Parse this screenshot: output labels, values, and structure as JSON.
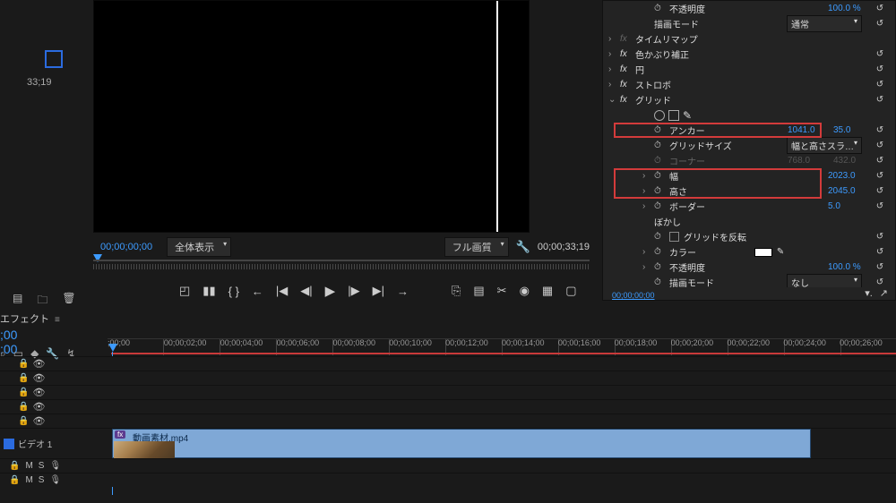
{
  "monitor": {
    "timecode_left": "00;00;00;00",
    "fit_label": "全体表示",
    "quality_label": "フル画質",
    "timecode_right": "00;00;33;19",
    "thumb_tc": "33;19"
  },
  "transport_icons": [
    "◰",
    "▮▮",
    "{ }",
    "←",
    "|◀",
    "◀|",
    "▶",
    "|▶",
    "▶|",
    "→"
  ],
  "transport_icons_r": [
    "⎘",
    "▤",
    "✂",
    "◉",
    "▦",
    "▢"
  ],
  "effects_panel": {
    "footer_tc": "00;00;00;00",
    "rows": [
      {
        "type": "sub2",
        "sw": "⏱",
        "name": "不透明度",
        "val": "100.0 %",
        "reset": "↺"
      },
      {
        "type": "sub2",
        "name": "描画モード",
        "dd": "通常",
        "reset": "↺"
      },
      {
        "type": "fx",
        "exp": "›",
        "fx": "fx",
        "fx_off": true,
        "name": "タイムリマップ"
      },
      {
        "type": "fx",
        "exp": "›",
        "fx": "fx",
        "name": "色かぶり補正",
        "reset": "↺"
      },
      {
        "type": "fx",
        "exp": "›",
        "fx": "fx",
        "name": "円",
        "reset": "↺"
      },
      {
        "type": "fx",
        "exp": "›",
        "fx": "fx",
        "name": "ストロボ",
        "reset": "↺"
      },
      {
        "type": "fx",
        "exp": "⌄",
        "fx": "fx",
        "name": "グリッド",
        "reset": "↺"
      },
      {
        "type": "shapes"
      },
      {
        "type": "sub2",
        "sw": "⏱",
        "name": "アンカー",
        "val": "1041.0",
        "val2": "35.0",
        "reset": "↺",
        "hl": true
      },
      {
        "type": "sub2",
        "sw": "⏱",
        "name": "グリッドサイズ",
        "dd": "幅と高さスラ…",
        "reset": "↺"
      },
      {
        "type": "sub2",
        "sw_off": "⏱",
        "dim": true,
        "name": "コーナー",
        "val": "768.0",
        "val2": "432.0",
        "reset": "↺"
      },
      {
        "type": "sub2",
        "exp": "›",
        "sw": "⏱",
        "name": "幅",
        "val": "2023.0",
        "reset": "↺",
        "hl": true,
        "hl_group": "b"
      },
      {
        "type": "sub2",
        "exp": "›",
        "sw": "⏱",
        "name": "高さ",
        "val": "2045.0",
        "reset": "↺",
        "hl_group": "b"
      },
      {
        "type": "sub2",
        "exp": "›",
        "sw": "⏱",
        "name": "ボーダー",
        "val": "5.0",
        "reset": "↺"
      },
      {
        "type": "sub2",
        "name": "ぼかし"
      },
      {
        "type": "sub2",
        "sw": "⏱",
        "chk": true,
        "name_after": "グリッドを反転",
        "reset": "↺"
      },
      {
        "type": "sub2",
        "exp": "›",
        "sw": "⏱",
        "name": "カラー",
        "swatch": true,
        "reset": "↺"
      },
      {
        "type": "sub2",
        "exp": "›",
        "sw": "⏱",
        "name": "不透明度",
        "val": "100.0 %",
        "reset": "↺"
      },
      {
        "type": "sub2",
        "sw": "⏱",
        "name": "描画モード",
        "dd": "なし",
        "reset": "↺"
      }
    ]
  },
  "tab": {
    "label": "エフェクト",
    "timecode": ";00\n:00"
  },
  "timeline": {
    "labels": [
      ";00;00",
      "00;00;02;00",
      "00;00;04;00",
      "00;00;06;00",
      "00;00;08;00",
      "00;00;10;00",
      "00;00;12;00",
      "00;00;14;00",
      "00;00;16;00",
      "00;00;18;00",
      "00;00;20;00",
      "00;00;22;00",
      "00;00;24;00",
      "00;00;26;00"
    ],
    "clip_title": "動画素材.mp4",
    "v1_label": "ビデオ 1"
  }
}
